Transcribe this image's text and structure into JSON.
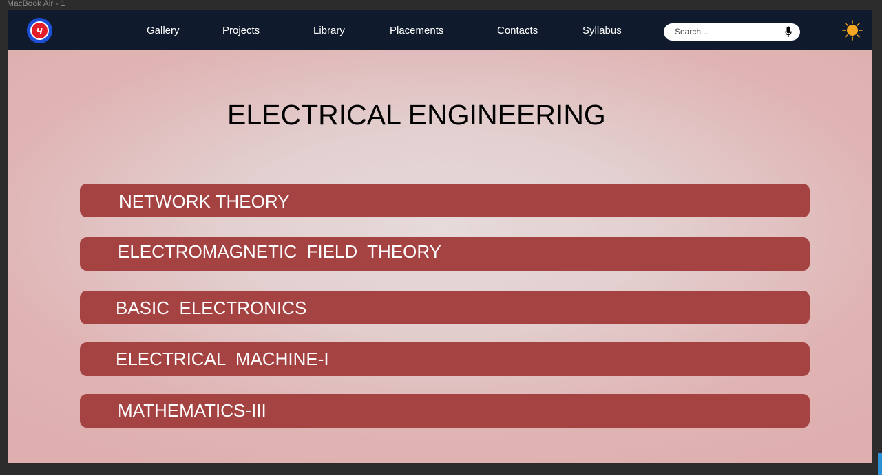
{
  "window": {
    "frame_label": "MacBook Air - 1"
  },
  "header": {
    "logo_text": "ч",
    "nav": [
      {
        "label": "Gallery"
      },
      {
        "label": "Projects"
      },
      {
        "label": "Library"
      },
      {
        "label": "Placements"
      },
      {
        "label": "Contacts"
      },
      {
        "label": "Syllabus"
      }
    ],
    "search": {
      "placeholder": "Search..."
    },
    "theme_icon": "sun-icon"
  },
  "main": {
    "title": "ELECTRICAL ENGINEERING",
    "subjects": [
      {
        "label": "NETWORK THEORY"
      },
      {
        "label": "ELECTROMAGNETIC  FIELD  THEORY"
      },
      {
        "label": "BASIC  ELECTRONICS"
      },
      {
        "label": "ELECTRICAL  MACHINE-I"
      },
      {
        "label": "MATHEMATICS-III"
      }
    ]
  },
  "colors": {
    "navbar": "#0f1a2c",
    "subject_bar": "#a54343",
    "page_background": "#e0b4b4",
    "sun": "#f5a623"
  }
}
